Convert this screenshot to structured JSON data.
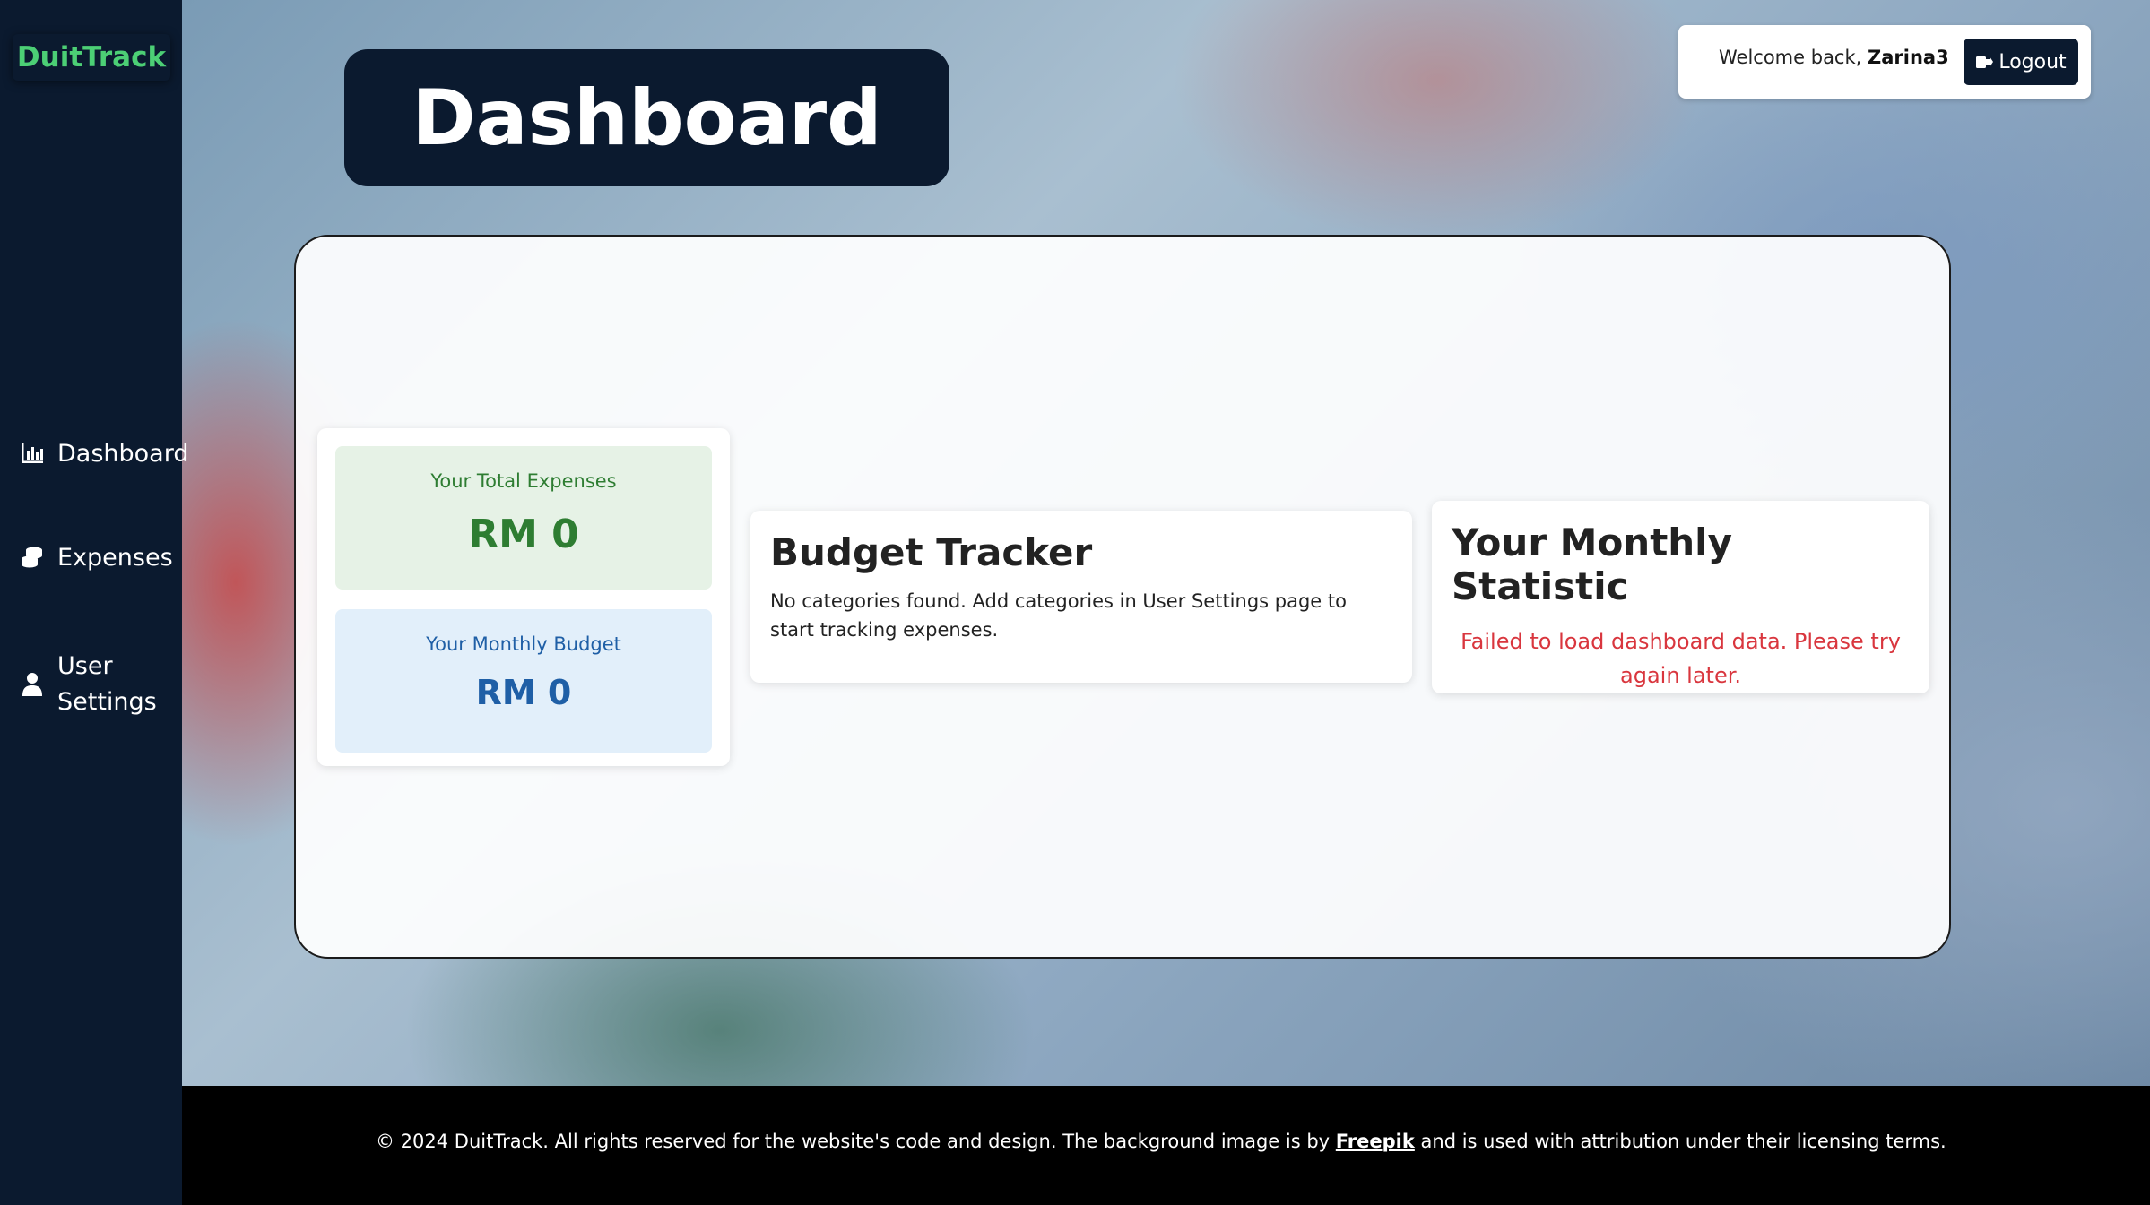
{
  "app": {
    "brand": "DuitTrack"
  },
  "sidebar": {
    "items": [
      {
        "label": "Dashboard",
        "icon": "bar-chart-icon"
      },
      {
        "label": "Expenses",
        "icon": "coins-icon"
      },
      {
        "label": "User Settings",
        "icon": "user-icon"
      }
    ]
  },
  "header": {
    "title": "Dashboard",
    "welcome_prefix": "Welcome back, ",
    "username": "Zarina3",
    "logout_label": "Logout"
  },
  "summary": {
    "expenses_label": "Your Total Expenses",
    "expenses_value": "RM 0",
    "budget_label": "Your Monthly Budget",
    "budget_value": "RM 0"
  },
  "budget_tracker": {
    "title": "Budget Tracker",
    "message": "No categories found. Add categories in User Settings page to start tracking expenses."
  },
  "monthly_statistic": {
    "title": "Your Monthly Statistic",
    "error": "Failed to load dashboard data. Please try again later."
  },
  "footer": {
    "text_before": "© 2024 DuitTrack. All rights reserved for the website's code and design. The background image is by ",
    "link_label": "Freepik",
    "text_after": " and is used with attribution under their licensing terms."
  },
  "colors": {
    "sidebar_bg": "#0b1a2f",
    "brand": "#4ccf75",
    "expenses_text": "#2e7d32",
    "budget_text": "#1f5fa6",
    "error_text": "#d9363e"
  }
}
